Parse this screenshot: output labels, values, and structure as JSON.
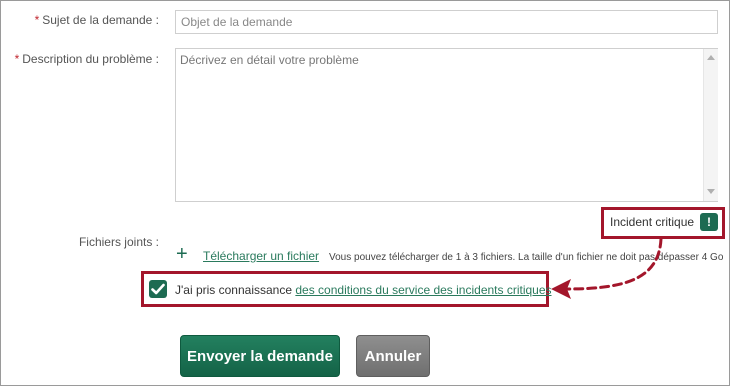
{
  "form": {
    "subject": {
      "required_mark": "*",
      "label": "Sujet de la demande :",
      "placeholder": "Objet de la demande",
      "value": ""
    },
    "description": {
      "required_mark": "*",
      "label": "Description du problème :",
      "placeholder": "Décrivez en détail votre problème",
      "value": ""
    },
    "critical": {
      "label": "Incident critique",
      "icon_text": "!"
    },
    "attachments": {
      "label": "Fichiers joints :",
      "add_icon": "+",
      "upload_link": "Télécharger un fichier",
      "hint": "Vous pouvez télécharger de 1 à 3 fichiers. La taille d'un fichier ne doit pas dépasser 4 Go"
    },
    "terms": {
      "checked": true,
      "text": "J'ai pris connaissance",
      "link": "des conditions du service des incidents critiques"
    },
    "buttons": {
      "submit": "Envoyer la demande",
      "cancel": "Annuler"
    }
  },
  "colors": {
    "accent": "#1d6b52",
    "highlight_border": "#a3162b",
    "required": "#c0262f",
    "cancel": "#7a7a7a"
  },
  "icons": {
    "critical": "exclamation-icon",
    "add": "plus-icon",
    "check": "check-icon",
    "annotation": "dashed-arrow"
  }
}
